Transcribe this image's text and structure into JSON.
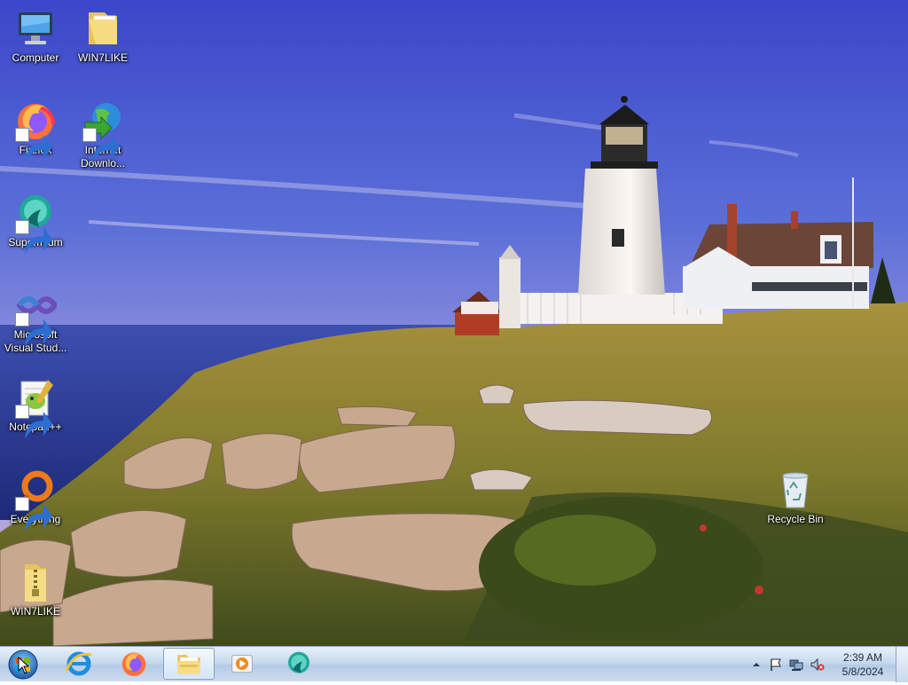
{
  "desktop": {
    "icons": [
      {
        "label": "Computer",
        "icon": "computer-icon"
      },
      {
        "label": "WIN7LIKE",
        "icon": "folder-icon"
      },
      {
        "label": "Firefox",
        "icon": "firefox-icon"
      },
      {
        "label": "Internet Downlo...",
        "icon": "internet-download-manager-icon"
      },
      {
        "label": "Supermium",
        "icon": "supermium-icon"
      },
      {
        "label": "Microsoft Visual Stud...",
        "icon": "visual-studio-icon"
      },
      {
        "label": "Notepad++",
        "icon": "notepad-plus-plus-icon"
      },
      {
        "label": "Everything",
        "icon": "everything-icon"
      },
      {
        "label": "WIN7LIKE",
        "icon": "zip-folder-icon"
      },
      {
        "label": "Recycle Bin",
        "icon": "recycle-bin-icon"
      }
    ]
  },
  "taskbar": {
    "start": "start-orb-icon",
    "pinned": [
      {
        "name": "internet-explorer",
        "icon": "internet-explorer-icon"
      },
      {
        "name": "firefox",
        "icon": "firefox-icon"
      },
      {
        "name": "file-explorer",
        "icon": "folder-icon",
        "active": true
      },
      {
        "name": "media-player",
        "icon": "media-player-icon"
      },
      {
        "name": "supermium",
        "icon": "supermium-icon"
      }
    ],
    "tray": {
      "icons": [
        "show-hidden-icons-chevron-icon",
        "action-center-flag-icon",
        "network-icon",
        "volume-muted-icon"
      ],
      "time": "2:39 AM",
      "date": "5/8/2024"
    }
  },
  "colors": {
    "taskbar_top": "#e9f2fb",
    "taskbar_bottom": "#b5cbe5",
    "sky": "#4a5fd4",
    "label_text": "#ffffff"
  }
}
